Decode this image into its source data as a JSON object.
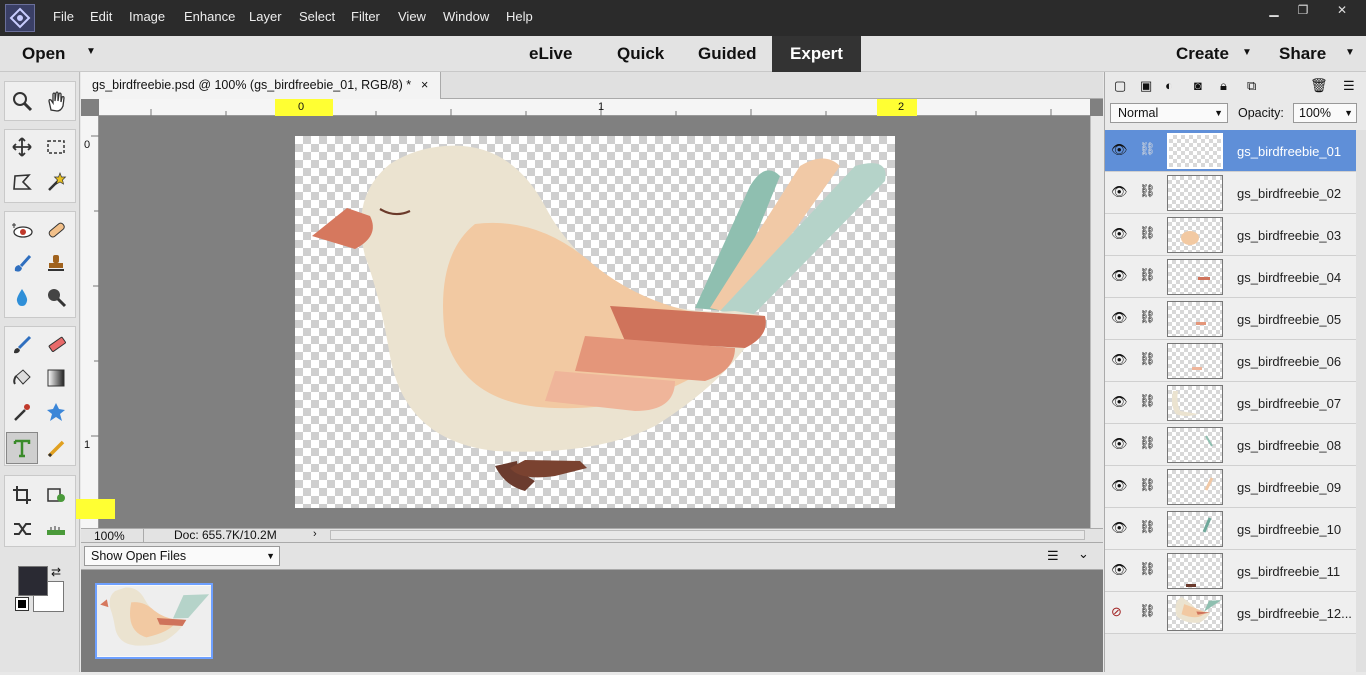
{
  "menu": [
    "File",
    "Edit",
    "Image",
    "Enhance",
    "Layer",
    "Select",
    "Filter",
    "View",
    "Window",
    "Help"
  ],
  "modes": {
    "open": "Open",
    "elive": "eLive",
    "quick": "Quick",
    "guided": "Guided",
    "expert": "Expert",
    "create": "Create",
    "share": "Share"
  },
  "document": {
    "tab_title": "gs_birdfreebie.psd @ 100% (gs_birdfreebie_01, RGB/8) *",
    "close": "×"
  },
  "ruler": {
    "h_labels": [
      "0",
      "1",
      "2"
    ],
    "v_labels": [
      "0",
      "1"
    ]
  },
  "status": {
    "zoom": "100%",
    "doc": "Doc: 655.7K/10.2M"
  },
  "bin": {
    "select": "Show Open Files"
  },
  "layers_panel": {
    "blend_mode": "Normal",
    "opacity_label": "Opacity:",
    "opacity": "100%",
    "layers": [
      {
        "name": "gs_birdfreebie_01",
        "visible": true,
        "selected": true
      },
      {
        "name": "gs_birdfreebie_02",
        "visible": true
      },
      {
        "name": "gs_birdfreebie_03",
        "visible": true
      },
      {
        "name": "gs_birdfreebie_04",
        "visible": true
      },
      {
        "name": "gs_birdfreebie_05",
        "visible": true
      },
      {
        "name": "gs_birdfreebie_06",
        "visible": true
      },
      {
        "name": "gs_birdfreebie_07",
        "visible": true
      },
      {
        "name": "gs_birdfreebie_08",
        "visible": true
      },
      {
        "name": "gs_birdfreebie_09",
        "visible": true
      },
      {
        "name": "gs_birdfreebie_10",
        "visible": true
      },
      {
        "name": "gs_birdfreebie_11",
        "visible": true
      },
      {
        "name": "gs_birdfreebie_12...",
        "visible": false
      }
    ]
  },
  "colors": {
    "accent": "#5f8fd8",
    "dark": "#333333",
    "highlight": "#ffff33"
  }
}
